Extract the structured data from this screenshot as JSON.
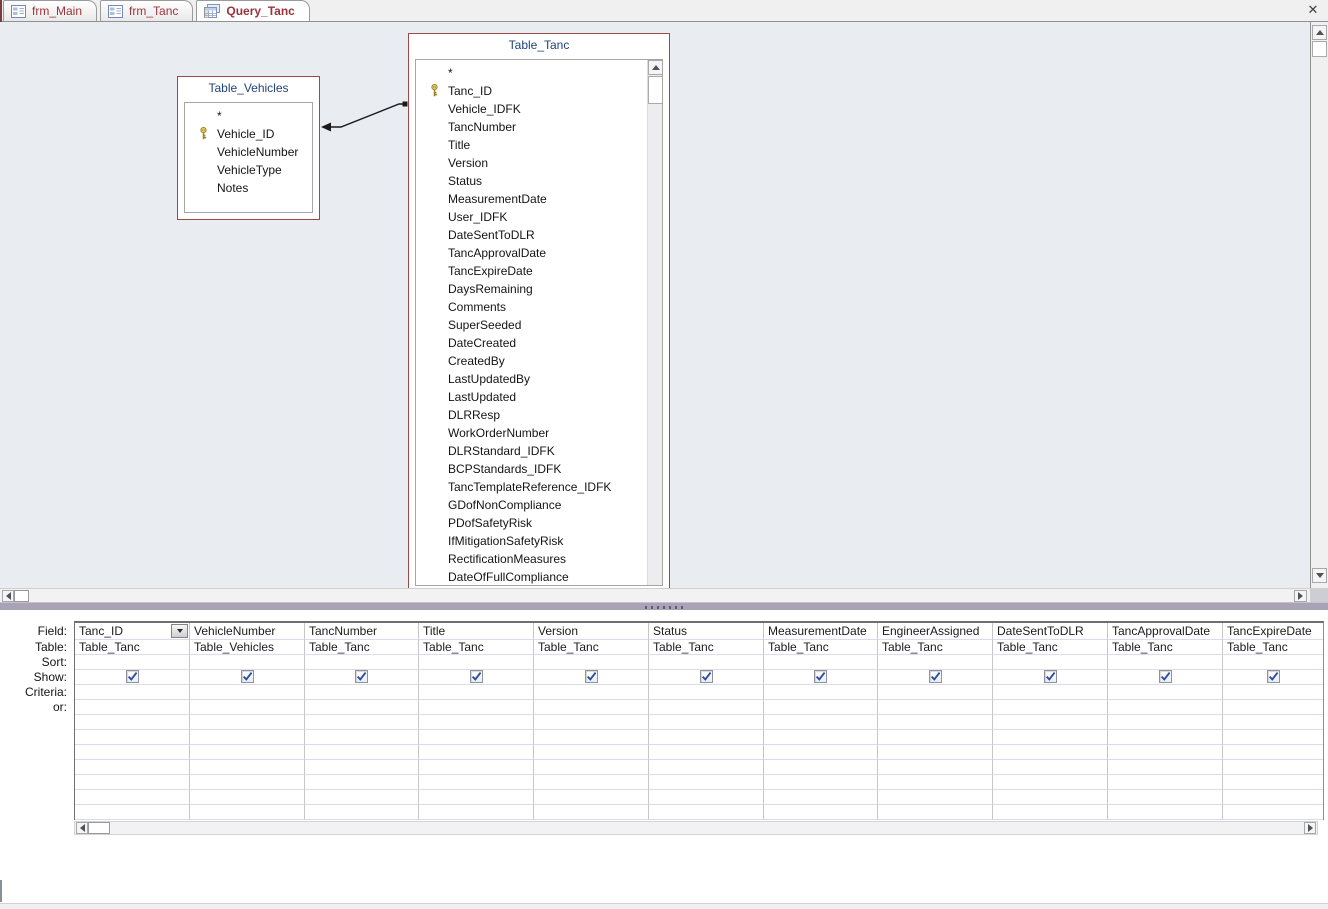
{
  "window": {
    "close_icon": "✕"
  },
  "tabs": [
    {
      "label": "frm_Main",
      "icon": "form-icon",
      "active": false
    },
    {
      "label": "frm_Tanc",
      "icon": "form-icon",
      "active": false
    },
    {
      "label": "Query_Tanc",
      "icon": "query-icon",
      "active": true
    }
  ],
  "design": {
    "tables": [
      {
        "name": "Table_Vehicles",
        "fields": [
          {
            "name": "*",
            "key": false
          },
          {
            "name": "Vehicle_ID",
            "key": true
          },
          {
            "name": "VehicleNumber",
            "key": false
          },
          {
            "name": "VehicleType",
            "key": false
          },
          {
            "name": "Notes",
            "key": false
          }
        ]
      },
      {
        "name": "Table_Tanc",
        "fields": [
          {
            "name": "*",
            "key": false
          },
          {
            "name": "Tanc_ID",
            "key": true
          },
          {
            "name": "Vehicle_IDFK",
            "key": false
          },
          {
            "name": "TancNumber",
            "key": false
          },
          {
            "name": "Title",
            "key": false
          },
          {
            "name": "Version",
            "key": false
          },
          {
            "name": "Status",
            "key": false
          },
          {
            "name": "MeasurementDate",
            "key": false
          },
          {
            "name": "User_IDFK",
            "key": false
          },
          {
            "name": "DateSentToDLR",
            "key": false
          },
          {
            "name": "TancApprovalDate",
            "key": false
          },
          {
            "name": "TancExpireDate",
            "key": false
          },
          {
            "name": "DaysRemaining",
            "key": false
          },
          {
            "name": "Comments",
            "key": false
          },
          {
            "name": "SuperSeeded",
            "key": false
          },
          {
            "name": "DateCreated",
            "key": false
          },
          {
            "name": "CreatedBy",
            "key": false
          },
          {
            "name": "LastUpdatedBy",
            "key": false
          },
          {
            "name": "LastUpdated",
            "key": false
          },
          {
            "name": "DLRResp",
            "key": false
          },
          {
            "name": "WorkOrderNumber",
            "key": false
          },
          {
            "name": "DLRStandard_IDFK",
            "key": false
          },
          {
            "name": "BCPStandards_IDFK",
            "key": false
          },
          {
            "name": "TancTemplateReference_IDFK",
            "key": false
          },
          {
            "name": "GDofNonCompliance",
            "key": false
          },
          {
            "name": "PDofSafetyRisk",
            "key": false
          },
          {
            "name": "IfMitigationSafetyRisk",
            "key": false
          },
          {
            "name": "RectificationMeasures",
            "key": false
          },
          {
            "name": "DateOfFullCompliance",
            "key": false
          }
        ]
      }
    ],
    "join": {
      "from_table": "Table_Vehicles",
      "from_field": "Vehicle_ID",
      "to_table": "Table_Tanc"
    }
  },
  "grid": {
    "row_labels": [
      "Field:",
      "Table:",
      "Sort:",
      "Show:",
      "Criteria:",
      "or:"
    ],
    "columns": [
      {
        "field": "Tanc_ID",
        "table": "Table_Tanc",
        "sort": "",
        "show": true,
        "criteria": "",
        "or": "",
        "dropdown": true
      },
      {
        "field": "VehicleNumber",
        "table": "Table_Vehicles",
        "sort": "",
        "show": true,
        "criteria": "",
        "or": ""
      },
      {
        "field": "TancNumber",
        "table": "Table_Tanc",
        "sort": "",
        "show": true,
        "criteria": "",
        "or": ""
      },
      {
        "field": "Title",
        "table": "Table_Tanc",
        "sort": "",
        "show": true,
        "criteria": "",
        "or": ""
      },
      {
        "field": "Version",
        "table": "Table_Tanc",
        "sort": "",
        "show": true,
        "criteria": "",
        "or": ""
      },
      {
        "field": "Status",
        "table": "Table_Tanc",
        "sort": "",
        "show": true,
        "criteria": "",
        "or": ""
      },
      {
        "field": "MeasurementDate",
        "table": "Table_Tanc",
        "sort": "",
        "show": true,
        "criteria": "",
        "or": ""
      },
      {
        "field": "EngineerAssigned",
        "table": "Table_Tanc",
        "sort": "",
        "show": true,
        "criteria": "",
        "or": ""
      },
      {
        "field": "DateSentToDLR",
        "table": "Table_Tanc",
        "sort": "",
        "show": true,
        "criteria": "",
        "or": ""
      },
      {
        "field": "TancApprovalDate",
        "table": "Table_Tanc",
        "sort": "",
        "show": true,
        "criteria": "",
        "or": ""
      },
      {
        "field": "TancExpireDate",
        "table": "Table_Tanc",
        "sort": "",
        "show": true,
        "criteria": "",
        "or": ""
      }
    ]
  },
  "colors": {
    "accent": "#9c323c",
    "table_border": "#9b4a47",
    "title_text": "#21437c",
    "design_bg": "#e9edf2",
    "splitter": "#a9a3b5",
    "check": "#2d4e9e"
  }
}
